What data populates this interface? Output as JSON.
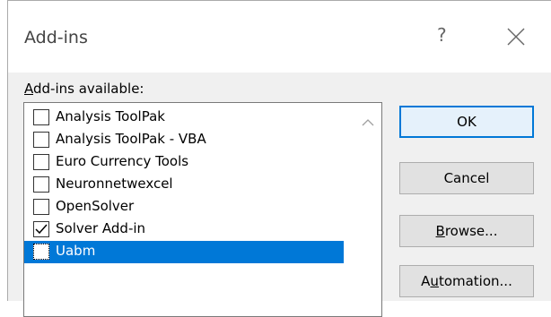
{
  "dialog": {
    "title": "Add-ins",
    "help_glyph": "?",
    "close_icon": "close-icon"
  },
  "addins": {
    "label_accel": "A",
    "label_rest": "dd-ins available:",
    "items": [
      {
        "label": "Analysis ToolPak",
        "checked": false,
        "selected": false
      },
      {
        "label": "Analysis ToolPak - VBA",
        "checked": false,
        "selected": false
      },
      {
        "label": "Euro Currency Tools",
        "checked": false,
        "selected": false
      },
      {
        "label": "Neuronnetwexcel",
        "checked": false,
        "selected": false
      },
      {
        "label": "OpenSolver",
        "checked": false,
        "selected": false
      },
      {
        "label": "Solver Add-in",
        "checked": true,
        "selected": false
      },
      {
        "label": "Uabm",
        "checked": false,
        "selected": true
      }
    ]
  },
  "buttons": {
    "ok": "OK",
    "cancel": "Cancel",
    "browse_accel": "B",
    "browse_rest": "rowse...",
    "automation_pre": "A",
    "automation_accel": "u",
    "automation_rest": "tomation..."
  },
  "colors": {
    "selection": "#0078d7",
    "dialog_bg": "#f0f0f0",
    "button_bg": "#e1e1e1",
    "default_button_bg": "#e5f1fb"
  }
}
